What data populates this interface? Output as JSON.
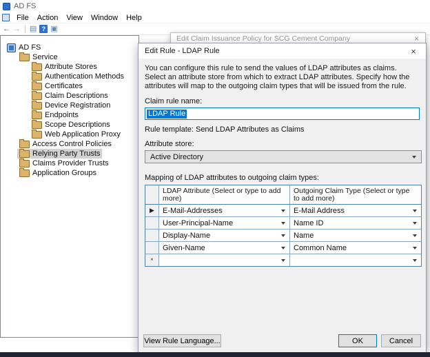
{
  "window": {
    "title": "AD FS",
    "menu": [
      "File",
      "Action",
      "View",
      "Window",
      "Help"
    ],
    "toolbar_icons": [
      {
        "name": "back-icon",
        "glyph": "←"
      },
      {
        "name": "forward-icon",
        "glyph": "→"
      },
      {
        "name": "show-tree-icon",
        "glyph": "▤"
      },
      {
        "name": "help-icon",
        "glyph": "?"
      },
      {
        "name": "window-icon",
        "glyph": "▣"
      }
    ]
  },
  "tree": {
    "items": [
      {
        "label": "AD FS",
        "level": 0,
        "icon": "root",
        "selected": false
      },
      {
        "label": "Service",
        "level": 1,
        "icon": "folder",
        "selected": false
      },
      {
        "label": "Attribute Stores",
        "level": 2,
        "icon": "folder",
        "selected": false
      },
      {
        "label": "Authentication Methods",
        "level": 2,
        "icon": "folder",
        "selected": false
      },
      {
        "label": "Certificates",
        "level": 2,
        "icon": "folder",
        "selected": false
      },
      {
        "label": "Claim Descriptions",
        "level": 2,
        "icon": "folder",
        "selected": false
      },
      {
        "label": "Device Registration",
        "level": 2,
        "icon": "folder",
        "selected": false
      },
      {
        "label": "Endpoints",
        "level": 2,
        "icon": "folder",
        "selected": false
      },
      {
        "label": "Scope Descriptions",
        "level": 2,
        "icon": "folder",
        "selected": false
      },
      {
        "label": "Web Application Proxy",
        "level": 2,
        "icon": "folder",
        "selected": false
      },
      {
        "label": "Access Control Policies",
        "level": 1,
        "icon": "folder",
        "selected": false
      },
      {
        "label": "Relying Party Trusts",
        "level": 1,
        "icon": "folder",
        "selected": true
      },
      {
        "label": "Claims Provider Trusts",
        "level": 1,
        "icon": "folder",
        "selected": false
      },
      {
        "label": "Application Groups",
        "level": 1,
        "icon": "folder",
        "selected": false
      }
    ]
  },
  "background_dialog": {
    "title": "Edit Claim Issuance Policy for SCG Cement Company",
    "close": "×"
  },
  "dialog": {
    "title": "Edit Rule - LDAP Rule",
    "close": "×",
    "description": "You can configure this rule to send the values of LDAP attributes as claims. Select an attribute store from which to extract LDAP attributes. Specify how the attributes will map to the outgoing claim types that will be issued from the rule.",
    "claim_rule_name_label": "Claim rule name:",
    "claim_rule_name_value": "LDAP Rule",
    "rule_template": "Rule template: Send LDAP Attributes as Claims",
    "attribute_store_label": "Attribute store:",
    "attribute_store_value": "Active Directory",
    "mapping_label": "Mapping of LDAP attributes to outgoing claim types:",
    "table": {
      "headers": [
        "LDAP Attribute (Select or type to add more)",
        "Outgoing Claim Type (Select or type to add more)"
      ],
      "rows": [
        {
          "marker": "▶",
          "ldap": "E-Mail-Addresses",
          "claim": "E-Mail Address"
        },
        {
          "marker": "",
          "ldap": "User-Principal-Name",
          "claim": "Name ID"
        },
        {
          "marker": "",
          "ldap": "Display-Name",
          "claim": "Name"
        },
        {
          "marker": "",
          "ldap": "Given-Name",
          "claim": "Common Name"
        },
        {
          "marker": "*",
          "ldap": "",
          "claim": ""
        }
      ]
    },
    "buttons": {
      "view_rule_language": "View Rule Language...",
      "ok": "OK",
      "cancel": "Cancel"
    }
  }
}
